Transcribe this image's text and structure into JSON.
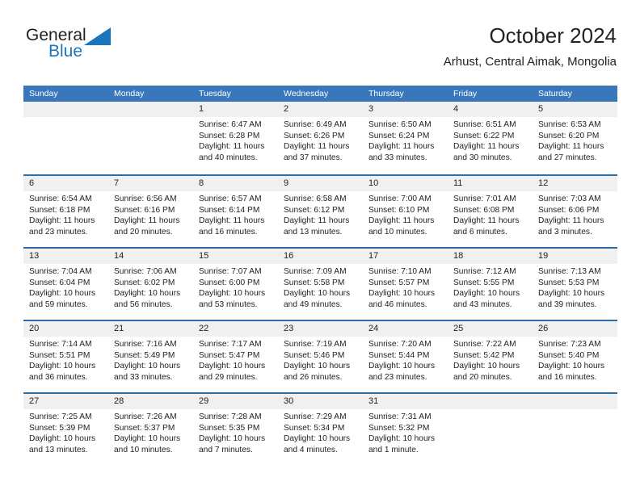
{
  "brand": {
    "name_part1": "General",
    "name_part2": "Blue",
    "triangle_color": "#1c75bc",
    "text_color": "#231f20"
  },
  "header": {
    "title": "October 2024",
    "subtitle": "Arhust, Central Aimak, Mongolia"
  },
  "theme": {
    "header_bar_color": "#3a77ba",
    "row_divider_color": "#2e6da4",
    "day_strip_color": "#f0f0f0",
    "text_color": "#222222"
  },
  "weekdays": [
    "Sunday",
    "Monday",
    "Tuesday",
    "Wednesday",
    "Thursday",
    "Friday",
    "Saturday"
  ],
  "labels": {
    "sunrise_prefix": "Sunrise:",
    "sunset_prefix": "Sunset:",
    "daylight_prefix": "Daylight:"
  },
  "weeks": [
    [
      {
        "day": "",
        "sunrise": "",
        "sunset": "",
        "daylight_line1": "",
        "daylight_line2": ""
      },
      {
        "day": "",
        "sunrise": "",
        "sunset": "",
        "daylight_line1": "",
        "daylight_line2": ""
      },
      {
        "day": "1",
        "sunrise": "Sunrise: 6:47 AM",
        "sunset": "Sunset: 6:28 PM",
        "daylight_line1": "Daylight: 11 hours",
        "daylight_line2": "and 40 minutes."
      },
      {
        "day": "2",
        "sunrise": "Sunrise: 6:49 AM",
        "sunset": "Sunset: 6:26 PM",
        "daylight_line1": "Daylight: 11 hours",
        "daylight_line2": "and 37 minutes."
      },
      {
        "day": "3",
        "sunrise": "Sunrise: 6:50 AM",
        "sunset": "Sunset: 6:24 PM",
        "daylight_line1": "Daylight: 11 hours",
        "daylight_line2": "and 33 minutes."
      },
      {
        "day": "4",
        "sunrise": "Sunrise: 6:51 AM",
        "sunset": "Sunset: 6:22 PM",
        "daylight_line1": "Daylight: 11 hours",
        "daylight_line2": "and 30 minutes."
      },
      {
        "day": "5",
        "sunrise": "Sunrise: 6:53 AM",
        "sunset": "Sunset: 6:20 PM",
        "daylight_line1": "Daylight: 11 hours",
        "daylight_line2": "and 27 minutes."
      }
    ],
    [
      {
        "day": "6",
        "sunrise": "Sunrise: 6:54 AM",
        "sunset": "Sunset: 6:18 PM",
        "daylight_line1": "Daylight: 11 hours",
        "daylight_line2": "and 23 minutes."
      },
      {
        "day": "7",
        "sunrise": "Sunrise: 6:56 AM",
        "sunset": "Sunset: 6:16 PM",
        "daylight_line1": "Daylight: 11 hours",
        "daylight_line2": "and 20 minutes."
      },
      {
        "day": "8",
        "sunrise": "Sunrise: 6:57 AM",
        "sunset": "Sunset: 6:14 PM",
        "daylight_line1": "Daylight: 11 hours",
        "daylight_line2": "and 16 minutes."
      },
      {
        "day": "9",
        "sunrise": "Sunrise: 6:58 AM",
        "sunset": "Sunset: 6:12 PM",
        "daylight_line1": "Daylight: 11 hours",
        "daylight_line2": "and 13 minutes."
      },
      {
        "day": "10",
        "sunrise": "Sunrise: 7:00 AM",
        "sunset": "Sunset: 6:10 PM",
        "daylight_line1": "Daylight: 11 hours",
        "daylight_line2": "and 10 minutes."
      },
      {
        "day": "11",
        "sunrise": "Sunrise: 7:01 AM",
        "sunset": "Sunset: 6:08 PM",
        "daylight_line1": "Daylight: 11 hours",
        "daylight_line2": "and 6 minutes."
      },
      {
        "day": "12",
        "sunrise": "Sunrise: 7:03 AM",
        "sunset": "Sunset: 6:06 PM",
        "daylight_line1": "Daylight: 11 hours",
        "daylight_line2": "and 3 minutes."
      }
    ],
    [
      {
        "day": "13",
        "sunrise": "Sunrise: 7:04 AM",
        "sunset": "Sunset: 6:04 PM",
        "daylight_line1": "Daylight: 10 hours",
        "daylight_line2": "and 59 minutes."
      },
      {
        "day": "14",
        "sunrise": "Sunrise: 7:06 AM",
        "sunset": "Sunset: 6:02 PM",
        "daylight_line1": "Daylight: 10 hours",
        "daylight_line2": "and 56 minutes."
      },
      {
        "day": "15",
        "sunrise": "Sunrise: 7:07 AM",
        "sunset": "Sunset: 6:00 PM",
        "daylight_line1": "Daylight: 10 hours",
        "daylight_line2": "and 53 minutes."
      },
      {
        "day": "16",
        "sunrise": "Sunrise: 7:09 AM",
        "sunset": "Sunset: 5:58 PM",
        "daylight_line1": "Daylight: 10 hours",
        "daylight_line2": "and 49 minutes."
      },
      {
        "day": "17",
        "sunrise": "Sunrise: 7:10 AM",
        "sunset": "Sunset: 5:57 PM",
        "daylight_line1": "Daylight: 10 hours",
        "daylight_line2": "and 46 minutes."
      },
      {
        "day": "18",
        "sunrise": "Sunrise: 7:12 AM",
        "sunset": "Sunset: 5:55 PM",
        "daylight_line1": "Daylight: 10 hours",
        "daylight_line2": "and 43 minutes."
      },
      {
        "day": "19",
        "sunrise": "Sunrise: 7:13 AM",
        "sunset": "Sunset: 5:53 PM",
        "daylight_line1": "Daylight: 10 hours",
        "daylight_line2": "and 39 minutes."
      }
    ],
    [
      {
        "day": "20",
        "sunrise": "Sunrise: 7:14 AM",
        "sunset": "Sunset: 5:51 PM",
        "daylight_line1": "Daylight: 10 hours",
        "daylight_line2": "and 36 minutes."
      },
      {
        "day": "21",
        "sunrise": "Sunrise: 7:16 AM",
        "sunset": "Sunset: 5:49 PM",
        "daylight_line1": "Daylight: 10 hours",
        "daylight_line2": "and 33 minutes."
      },
      {
        "day": "22",
        "sunrise": "Sunrise: 7:17 AM",
        "sunset": "Sunset: 5:47 PM",
        "daylight_line1": "Daylight: 10 hours",
        "daylight_line2": "and 29 minutes."
      },
      {
        "day": "23",
        "sunrise": "Sunrise: 7:19 AM",
        "sunset": "Sunset: 5:46 PM",
        "daylight_line1": "Daylight: 10 hours",
        "daylight_line2": "and 26 minutes."
      },
      {
        "day": "24",
        "sunrise": "Sunrise: 7:20 AM",
        "sunset": "Sunset: 5:44 PM",
        "daylight_line1": "Daylight: 10 hours",
        "daylight_line2": "and 23 minutes."
      },
      {
        "day": "25",
        "sunrise": "Sunrise: 7:22 AM",
        "sunset": "Sunset: 5:42 PM",
        "daylight_line1": "Daylight: 10 hours",
        "daylight_line2": "and 20 minutes."
      },
      {
        "day": "26",
        "sunrise": "Sunrise: 7:23 AM",
        "sunset": "Sunset: 5:40 PM",
        "daylight_line1": "Daylight: 10 hours",
        "daylight_line2": "and 16 minutes."
      }
    ],
    [
      {
        "day": "27",
        "sunrise": "Sunrise: 7:25 AM",
        "sunset": "Sunset: 5:39 PM",
        "daylight_line1": "Daylight: 10 hours",
        "daylight_line2": "and 13 minutes."
      },
      {
        "day": "28",
        "sunrise": "Sunrise: 7:26 AM",
        "sunset": "Sunset: 5:37 PM",
        "daylight_line1": "Daylight: 10 hours",
        "daylight_line2": "and 10 minutes."
      },
      {
        "day": "29",
        "sunrise": "Sunrise: 7:28 AM",
        "sunset": "Sunset: 5:35 PM",
        "daylight_line1": "Daylight: 10 hours",
        "daylight_line2": "and 7 minutes."
      },
      {
        "day": "30",
        "sunrise": "Sunrise: 7:29 AM",
        "sunset": "Sunset: 5:34 PM",
        "daylight_line1": "Daylight: 10 hours",
        "daylight_line2": "and 4 minutes."
      },
      {
        "day": "31",
        "sunrise": "Sunrise: 7:31 AM",
        "sunset": "Sunset: 5:32 PM",
        "daylight_line1": "Daylight: 10 hours",
        "daylight_line2": "and 1 minute."
      },
      {
        "day": "",
        "sunrise": "",
        "sunset": "",
        "daylight_line1": "",
        "daylight_line2": ""
      },
      {
        "day": "",
        "sunrise": "",
        "sunset": "",
        "daylight_line1": "",
        "daylight_line2": ""
      }
    ]
  ]
}
